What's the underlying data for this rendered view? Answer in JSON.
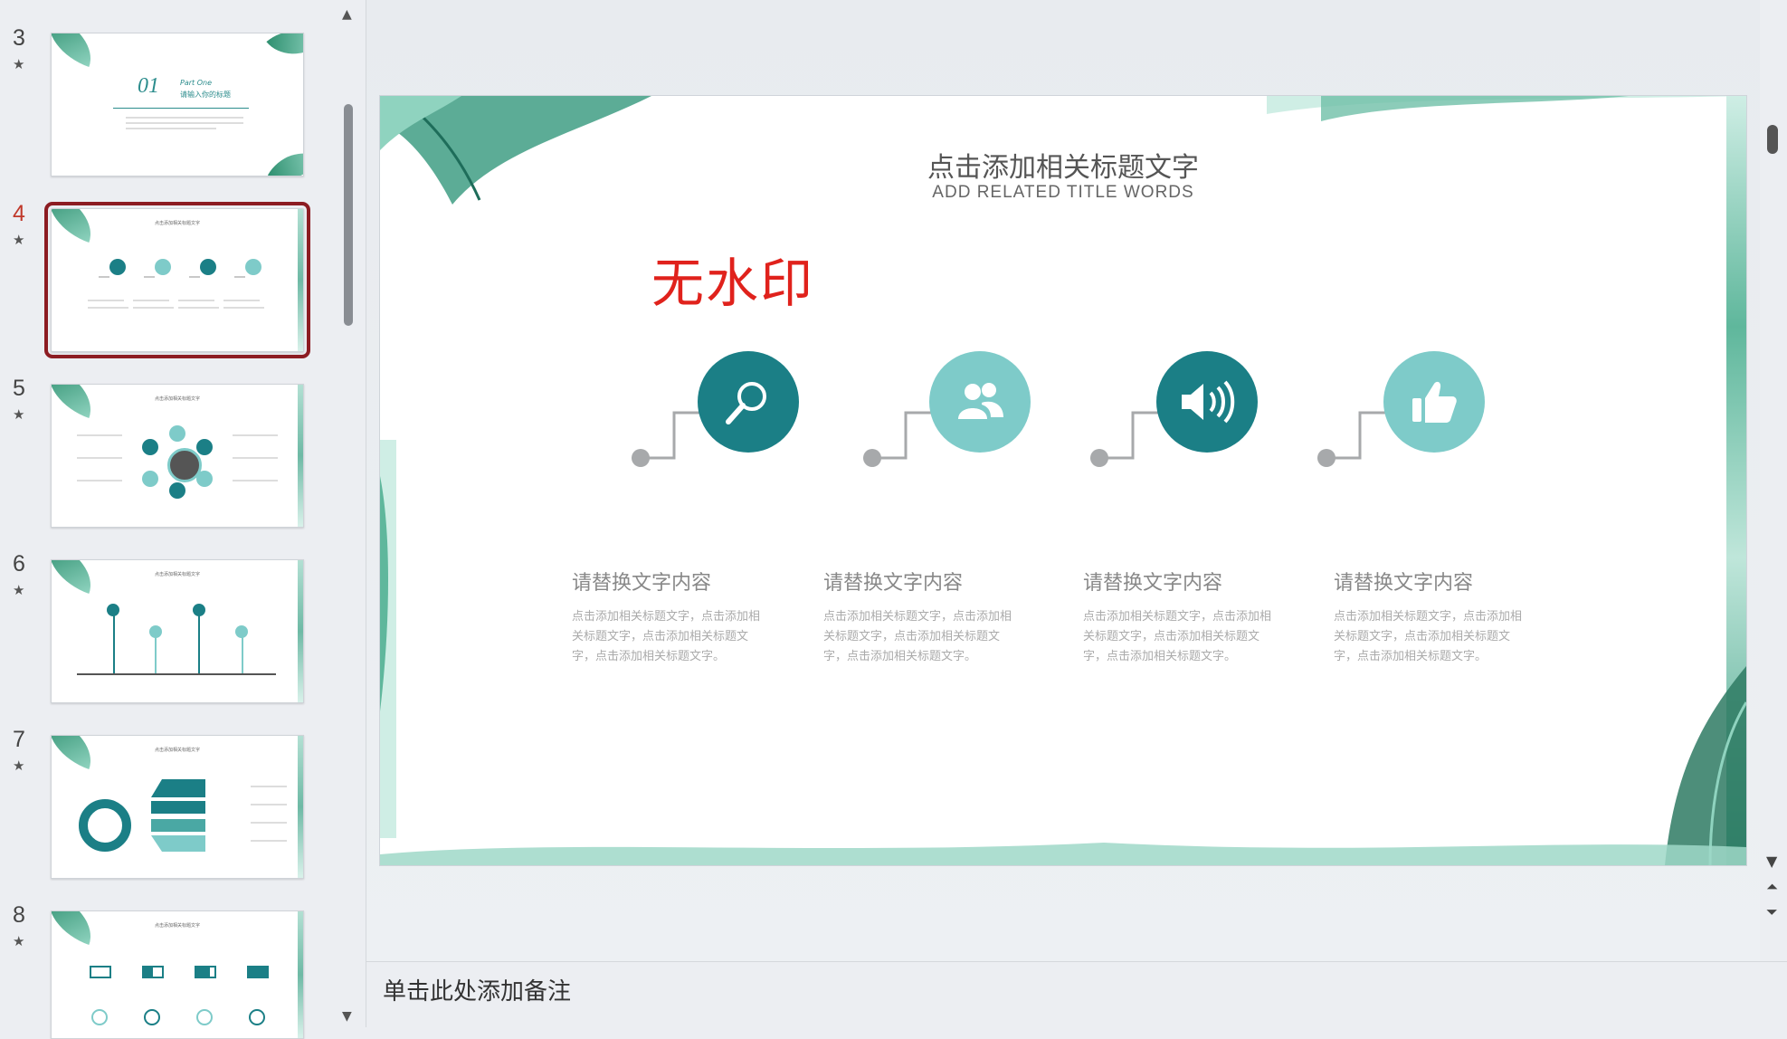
{
  "thumbnails": [
    {
      "number": "3",
      "title": "01",
      "part": "Part One",
      "subtitle": "请输入你的标题"
    },
    {
      "number": "4",
      "title": "点击添加相关标题文字"
    },
    {
      "number": "5",
      "title": "点击添加相关标题文字"
    },
    {
      "number": "6",
      "title": "点击添加相关标题文字"
    },
    {
      "number": "7",
      "title": "点击添加相关标题文字"
    },
    {
      "number": "8",
      "title": "点击添加相关标题文字"
    }
  ],
  "slide": {
    "title": "点击添加相关标题文字",
    "subtitle": "ADD RELATED TITLE WORDS",
    "watermark": "无水印",
    "items": [
      {
        "icon": "magnifier-icon",
        "color": "#1b7f86",
        "heading": "请替换文字内容",
        "body": "点击添加相关标题文字，点击添加相关标题文字，点击添加相关标题文字，点击添加相关标题文字。"
      },
      {
        "icon": "users-icon",
        "color": "#7ecbc9",
        "heading": "请替换文字内容",
        "body": "点击添加相关标题文字，点击添加相关标题文字，点击添加相关标题文字，点击添加相关标题文字。"
      },
      {
        "icon": "speaker-icon",
        "color": "#1b7f86",
        "heading": "请替换文字内容",
        "body": "点击添加相关标题文字，点击添加相关标题文字，点击添加相关标题文字，点击添加相关标题文字。"
      },
      {
        "icon": "thumbs-up-icon",
        "color": "#7ecbc9",
        "heading": "请替换文字内容",
        "body": "点击添加相关标题文字，点击添加相关标题文字，点击添加相关标题文字，点击添加相关标题文字。"
      }
    ]
  },
  "notes": {
    "placeholder": "单击此处添加备注"
  }
}
